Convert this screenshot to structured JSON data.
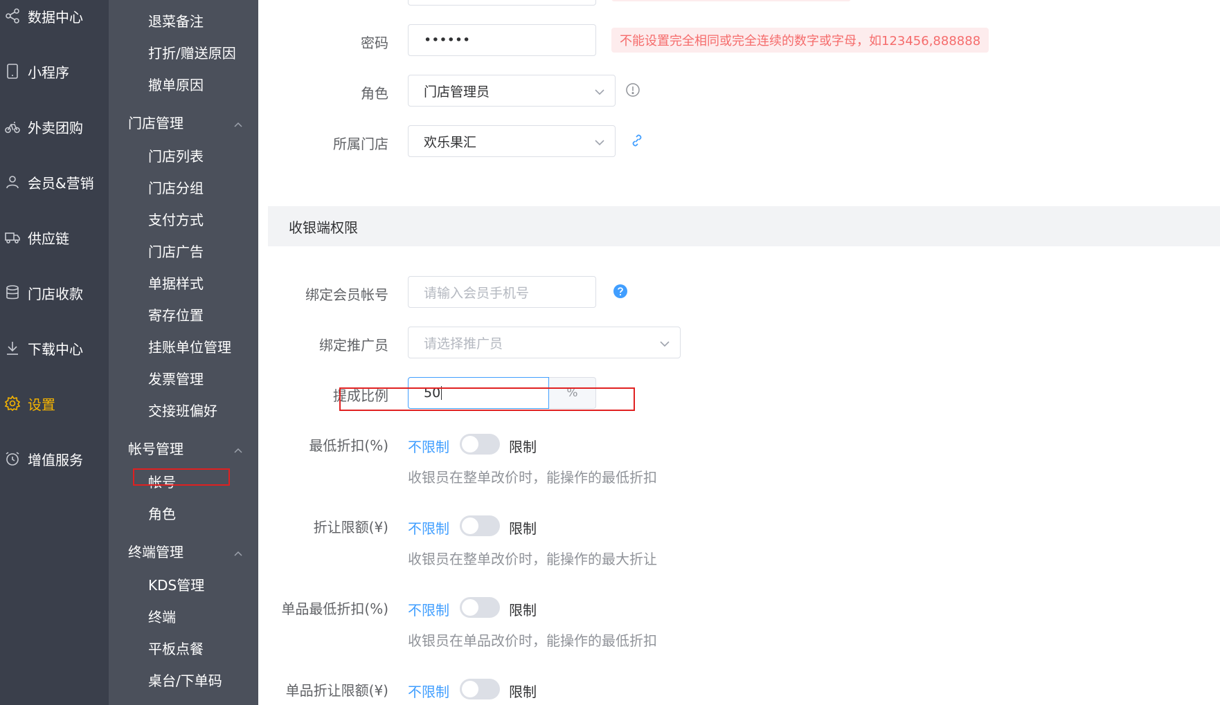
{
  "primary_nav": [
    {
      "label": "数据中心",
      "icon": "share-icon",
      "active": false
    },
    {
      "label": "小程序",
      "icon": "tablet-icon",
      "active": false
    },
    {
      "label": "外卖团购",
      "icon": "bicycle-icon",
      "active": false
    },
    {
      "label": "会员&营销",
      "icon": "user-icon",
      "active": false
    },
    {
      "label": "供应链",
      "icon": "truck-icon",
      "active": false
    },
    {
      "label": "门店收款",
      "icon": "database-icon",
      "active": false
    },
    {
      "label": "下载中心",
      "icon": "download-icon",
      "active": false
    },
    {
      "label": "设置",
      "icon": "gear-icon",
      "active": true
    },
    {
      "label": "增值服务",
      "icon": "alarm-clock-icon",
      "active": false
    }
  ],
  "secondary_nav": {
    "top_items": [
      "退菜备注",
      "打折/赠送原因",
      "撤单原因"
    ],
    "groups": [
      {
        "label": "门店管理",
        "items": [
          "门店列表",
          "门店分组",
          "支付方式",
          "门店广告",
          "单据样式",
          "寄存位置",
          "挂账单位管理",
          "发票管理",
          "交接班偏好"
        ]
      },
      {
        "label": "帐号管理",
        "items": [
          "帐号",
          "角色"
        ]
      },
      {
        "label": "终端管理",
        "items": [
          "KDS管理",
          "终端",
          "平板点餐",
          "桌台/下单码"
        ]
      }
    ]
  },
  "form": {
    "password": {
      "label": "密码",
      "value": "••••••",
      "error": "不能设置完全相同或完全连续的数字或字母，如123456,888888"
    },
    "role": {
      "label": "角色",
      "value": "门店管理员",
      "info_icon": "info-circle-icon"
    },
    "store": {
      "label": "所属门店",
      "value": "欢乐果汇",
      "link_icon": "link-icon"
    }
  },
  "cashier_section": {
    "title": "收银端权限",
    "bind_member": {
      "label": "绑定会员帐号",
      "placeholder": "请输入会员手机号",
      "help_icon": "question-circle-icon"
    },
    "bind_promoter": {
      "label": "绑定推广员",
      "placeholder": "请选择推广员"
    },
    "commission": {
      "label": "提成比例",
      "value": "50",
      "unit": "%"
    },
    "limits": [
      {
        "label": "最低折扣(%)",
        "unlimited": "不限制",
        "limited": "限制",
        "hint": "收银员在整单改价时，能操作的最低折扣"
      },
      {
        "label": "折让限额(¥)",
        "unlimited": "不限制",
        "limited": "限制",
        "hint": "收银员在整单改价时，能操作的最大折让"
      },
      {
        "label": "单品最低折扣(%)",
        "unlimited": "不限制",
        "limited": "限制",
        "hint": "收银员在单品改价时，能操作的最低折扣"
      },
      {
        "label": "单品折让限额(¥)",
        "unlimited": "不限制",
        "limited": "限制"
      }
    ]
  },
  "colors": {
    "accent": "#409eff",
    "active_nav": "#f7b500",
    "error": "#f56c6c",
    "highlight_box": "#e02020"
  }
}
